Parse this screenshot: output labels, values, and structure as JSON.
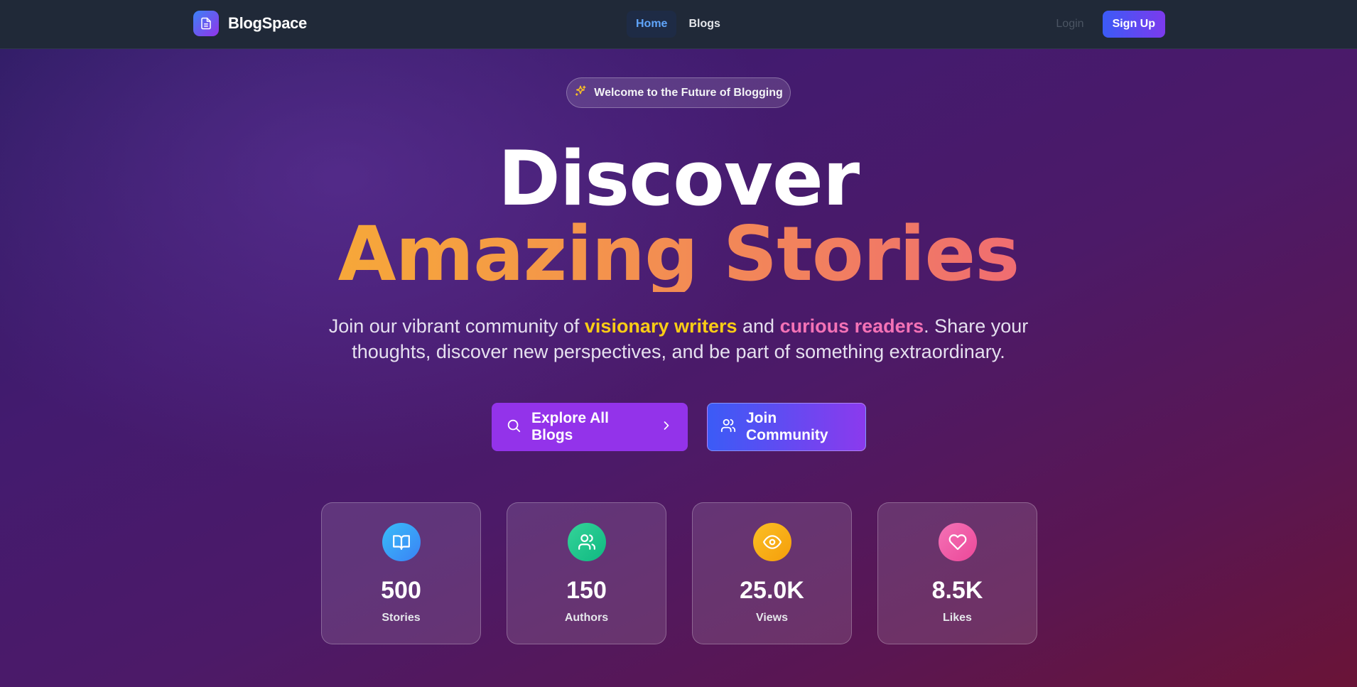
{
  "navbar": {
    "brand": "BlogSpace",
    "links": [
      {
        "label": "Home",
        "active": true
      },
      {
        "label": "Blogs",
        "active": false
      }
    ],
    "login_label": "Login",
    "signup_label": "Sign Up"
  },
  "hero": {
    "badge": "Welcome to the Future of Blogging",
    "headline_line1": "Discover",
    "headline_line2": "Amazing Stories",
    "subtitle": {
      "part1": "Join our vibrant community of ",
      "highlight1": "visionary writers",
      "part2": " and ",
      "highlight2": "curious readers",
      "part3": ". Share your thoughts, discover new perspectives, and be part of something extraordinary."
    },
    "buttons": {
      "explore_label": "Explore All Blogs",
      "join_label": "Join Community"
    }
  },
  "stats": [
    {
      "value": "500",
      "label": "Stories",
      "icon": "book-open-icon",
      "color": "#38bdf8"
    },
    {
      "value": "150",
      "label": "Authors",
      "icon": "users-icon",
      "color": "#34d399"
    },
    {
      "value": "25.0K",
      "label": "Views",
      "icon": "eye-icon",
      "color": "#fbbf24"
    },
    {
      "value": "8.5K",
      "label": "Likes",
      "icon": "heart-icon",
      "color": "#f472b6"
    }
  ],
  "colors": {
    "brand_gradient_start": "#3b82f6",
    "brand_gradient_end": "#9333ea",
    "accent_yellow": "#facc15",
    "accent_pink": "#f472b6",
    "active_link": "#60a5fa"
  }
}
